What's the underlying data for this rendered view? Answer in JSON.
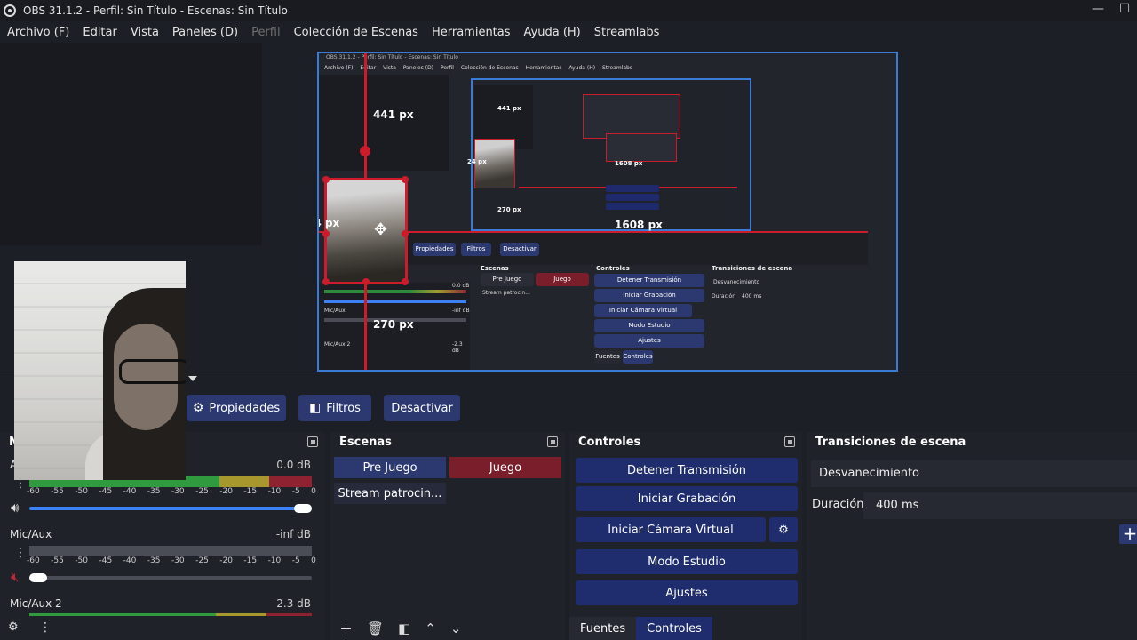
{
  "window": {
    "title": "OBS 31.1.2 - Perfil: Sin Título - Escenas: Sin Título",
    "minimize": "—",
    "maximize": "☐"
  },
  "menu": {
    "items": [
      "Archivo (F)",
      "Editar",
      "Vista",
      "Paneles (D)",
      "Perfil",
      "Colección de Escenas",
      "Herramientas",
      "Ayuda (H)",
      "Streamlabs"
    ]
  },
  "preview": {
    "inner_title": "OBS 31.1.2 - Perfil: Sin Título - Escenas: Sin Título",
    "inner_menu": [
      "Archivo (F)",
      "Editar",
      "Vista",
      "Paneles (D)",
      "Perfil",
      "Colección de Escenas",
      "Herramientas",
      "Ayuda (H)",
      "Streamlabs"
    ],
    "px_top": "441 px",
    "px_left": "24 px",
    "px_bottom": "270 px",
    "px_right": "1608 px",
    "inner_px_top": "441 px",
    "inner_px_left": "24 px",
    "inner_px_bottom": "270 px",
    "inner_px_right": "1608 px",
    "inner_props": "Propiedades",
    "inner_filters": "Filtros",
    "inner_deactivate": "Desactivar",
    "inner_scenes": "Escenas",
    "inner_controls": "Controles",
    "inner_transitions": "Transiciones de escena",
    "inner_scene1": "Pre Juego",
    "inner_scene2": "Juego",
    "inner_scene3": "Stream patrocin...",
    "inner_stop": "Detener Transmisión",
    "inner_record": "Iniciar Grabación",
    "inner_vcam": "Iniciar Cámara Virtual",
    "inner_studio": "Modo Estudio",
    "inner_settings": "Ajustes",
    "inner_fade": "Desvanecimiento",
    "inner_duration": "Duración",
    "inner_ms": "400 ms",
    "inner_mic": "Mic/Aux",
    "inner_mic2": "Mic/Aux 2",
    "inner_db1": "0.0 dB",
    "inner_db2": "-inf dB",
    "inner_db3": "-2.3 dB",
    "inner_tab1": "Fuentes",
    "inner_tab2": "Controles"
  },
  "toolbar": {
    "properties": "Propiedades",
    "filters": "Filtros",
    "deactivate": "Desactivar"
  },
  "mixer": {
    "title": "M",
    "channels": [
      {
        "name": "A",
        "db": "0.0 dB"
      },
      {
        "name": "Mic/Aux",
        "db": "-inf dB"
      },
      {
        "name": "Mic/Aux 2",
        "db": "-2.3 dB"
      }
    ],
    "scale": [
      "-60",
      "-55",
      "-50",
      "-45",
      "-40",
      "-35",
      "-30",
      "-25",
      "-20",
      "-15",
      "-10",
      "-5",
      "0"
    ]
  },
  "scenes": {
    "title": "Escenas",
    "items": [
      "Pre Juego",
      "Juego",
      "Stream patrocin..."
    ]
  },
  "controls": {
    "title": "Controles",
    "stop_stream": "Detener Transmisión",
    "start_record": "Iniciar Grabación",
    "virtual_cam": "Iniciar Cámara Virtual",
    "studio_mode": "Modo Estudio",
    "settings": "Ajustes"
  },
  "tabs": [
    "Fuentes",
    "Controles"
  ],
  "transitions": {
    "title": "Transiciones de escena",
    "selected": "Desvanecimiento",
    "duration_label": "Duración",
    "duration_value": "400 ms"
  },
  "colors": {
    "accent_blue": "#2c3970",
    "selected_red": "#7a1e2c",
    "highlight_red": "#cc1b2b",
    "preview_border": "#3a7bd5"
  }
}
